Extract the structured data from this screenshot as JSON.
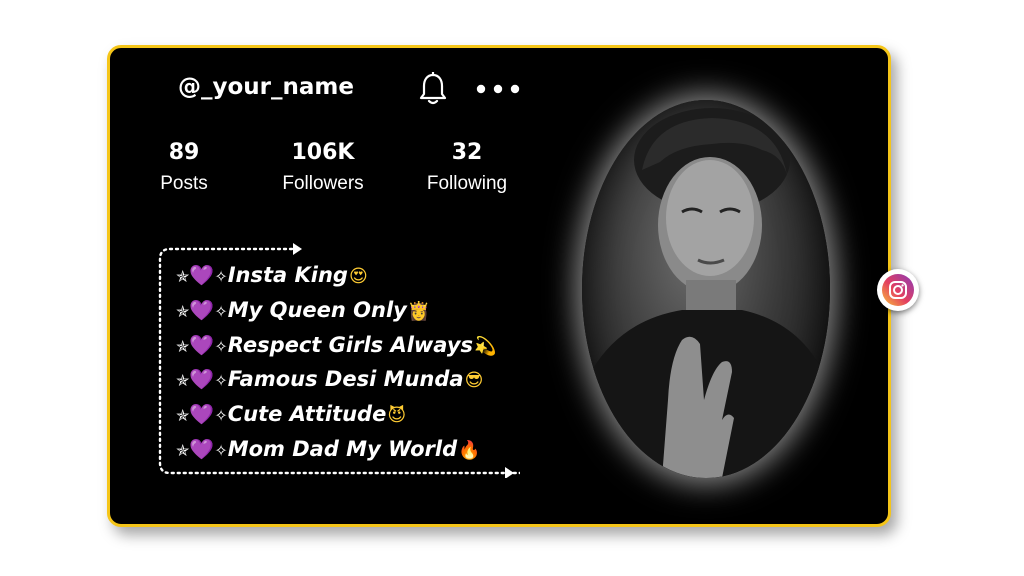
{
  "profile": {
    "username": "@_your_name",
    "stats": [
      {
        "value": "89",
        "label": "Posts"
      },
      {
        "value": "106K",
        "label": "Followers"
      },
      {
        "value": "32",
        "label": "Following"
      }
    ],
    "bio": [
      {
        "prefix_star": "✯",
        "heart": "💜",
        "sparkle": "✧",
        "text": "Insta King",
        "emoji": "😍"
      },
      {
        "prefix_star": "✯",
        "heart": "💜",
        "sparkle": "✧",
        "text": "My Queen Only",
        "emoji": "👸"
      },
      {
        "prefix_star": "✯",
        "heart": "💜",
        "sparkle": "✧",
        "text": "Respect Girls Always",
        "emoji": "💫"
      },
      {
        "prefix_star": "✯",
        "heart": "💜",
        "sparkle": "✧",
        "text": "Famous Desi Munda",
        "emoji": "😎"
      },
      {
        "prefix_star": "✯",
        "heart": "💜",
        "sparkle": "✧",
        "text": "Cute Attitude",
        "emoji": "😈"
      },
      {
        "prefix_star": "✯",
        "heart": "💜",
        "sparkle": "✧",
        "text": "Mom Dad My World",
        "emoji": "🔥"
      }
    ]
  },
  "icons": {
    "bell": "bell-icon",
    "more": "more-dots-icon",
    "instagram": "instagram-icon"
  },
  "colors": {
    "card_background": "#000000",
    "card_border": "#f5c518",
    "text": "#ffffff",
    "heart": "#a37be0"
  }
}
